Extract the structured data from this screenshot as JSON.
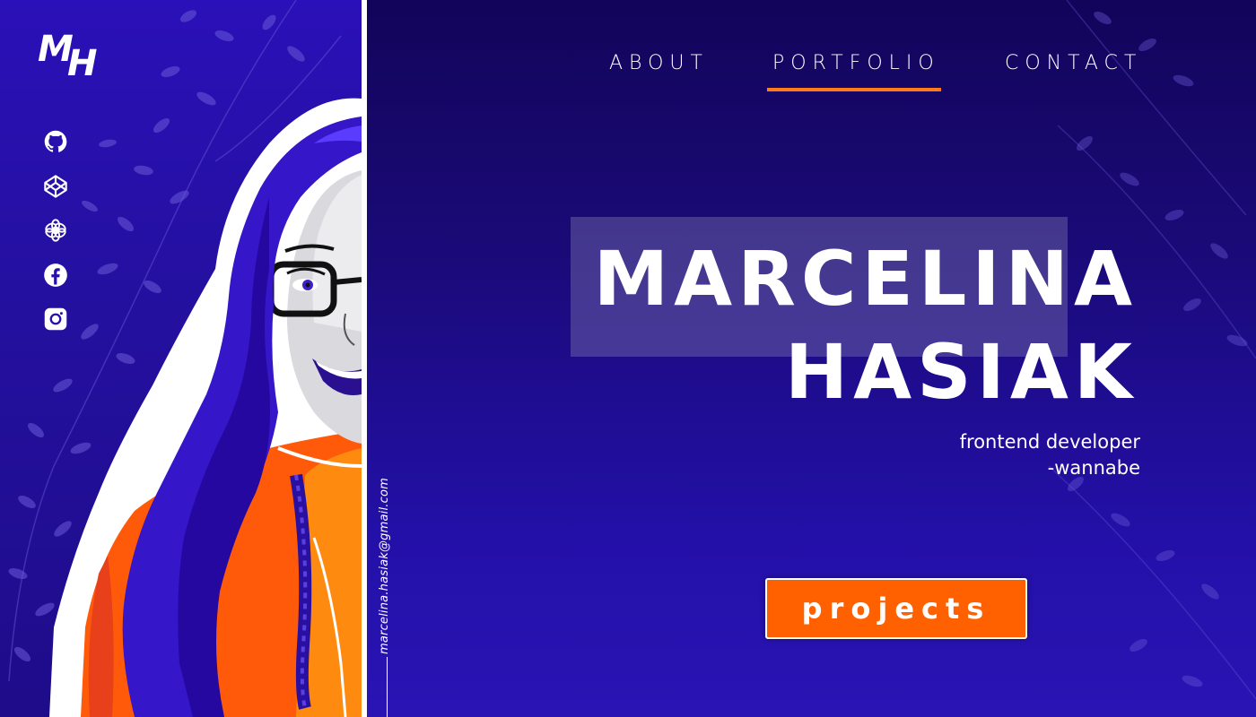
{
  "logo": {
    "m": "M",
    "h": "H"
  },
  "social": [
    {
      "name": "github-icon"
    },
    {
      "name": "codepen-icon"
    },
    {
      "name": "openai-icon"
    },
    {
      "name": "facebook-icon"
    },
    {
      "name": "instagram-icon"
    }
  ],
  "email": "marcelina.hasiak@gmail.com",
  "nav": {
    "about": "ABOUT",
    "portfolio": "PORTFOLIO",
    "contact": "CONTACT",
    "active": "PORTFOLIO"
  },
  "hero": {
    "first_name": "MARCELINA",
    "last_name": "HASIAK",
    "subtitle_1": "frontend developer",
    "subtitle_2": "-wannabe"
  },
  "cta": {
    "projects_label": "projects"
  },
  "colors": {
    "accent": "#ff6000",
    "underline": "#ff7a1a",
    "background": "#1a0866",
    "sidebar": "#2a10b8"
  }
}
